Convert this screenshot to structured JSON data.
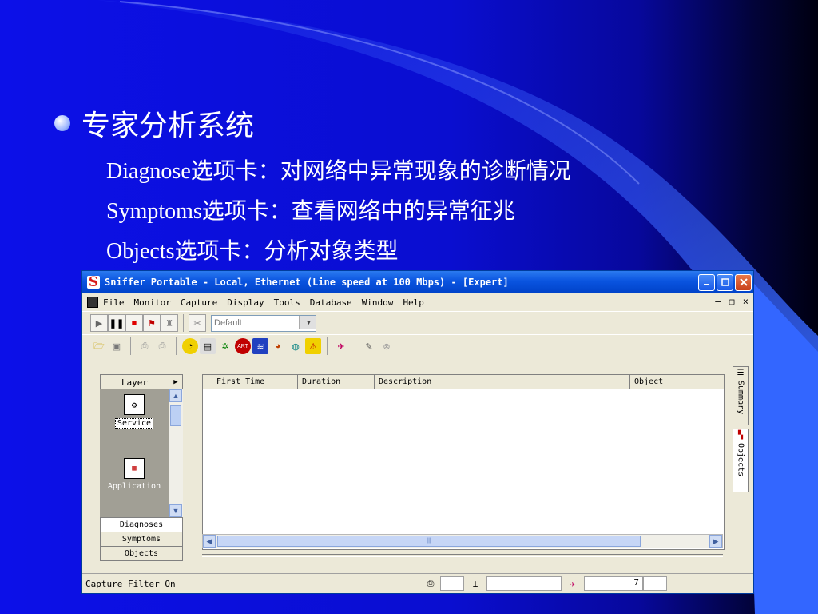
{
  "slide": {
    "title": "专家分析系统",
    "lines": [
      "Diagnose选项卡：对网络中异常现象的诊断情况",
      "Symptoms选项卡：查看网络中的异常征兆",
      "Objects选项卡：分析对象类型"
    ]
  },
  "window": {
    "title": "Sniffer Portable - Local, Ethernet (Line speed at 100 Mbps) - [Expert]",
    "app_icon_letter": "S",
    "menu": [
      "File",
      "Monitor",
      "Capture",
      "Display",
      "Tools",
      "Database",
      "Window",
      "Help"
    ],
    "profile_combo": "Default",
    "layer_header": "Layer",
    "layer_items": [
      "Service",
      "Application"
    ],
    "left_tabs": [
      "Diagnoses",
      "Symptoms",
      "Objects"
    ],
    "columns": [
      "First Time",
      "Duration",
      "Description",
      "Object"
    ],
    "right_tabs": [
      "Summary",
      "Objects"
    ],
    "status": {
      "text": "Capture Filter On",
      "count": "7"
    }
  },
  "colors": {
    "title_bar": "#0a54e0",
    "slide_bg": "#0c10e8",
    "window_bg": "#ece9d8"
  }
}
